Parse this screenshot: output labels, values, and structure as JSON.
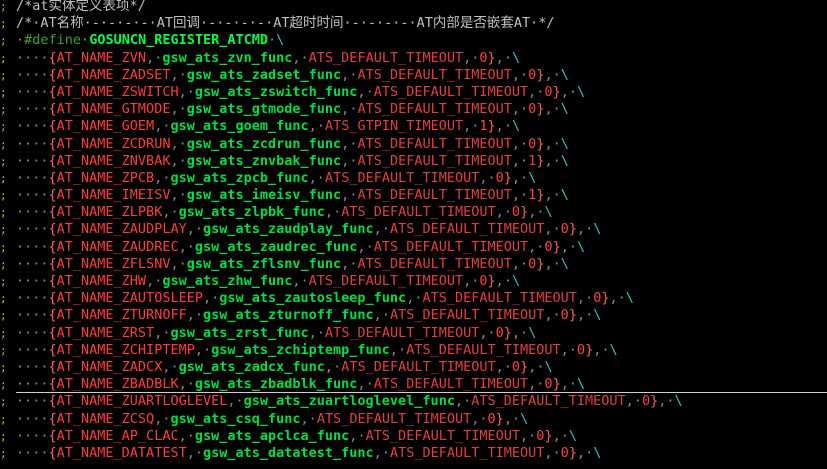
{
  "colors": {
    "background": "#000000",
    "comment": "#c0c0c0",
    "macro": "#00ff40",
    "function": "#00e040",
    "constant": "#ff3c3c",
    "continuation": "#40c0c0",
    "gutter_marker": "#c8c800"
  },
  "editor": {
    "comment_line_1": "/*at实体定义表项*/",
    "comment_line_2": "/*·AT名称·-·-·-·-·AT回调·-·-·-·-·AT超时时间·-·-·-·-·AT内部是否嵌套AT·*/",
    "define_keyword": "#define",
    "define_name": "GOSUNCN_REGISTER_ATCMD",
    "continuation": "\\",
    "entries": [
      {
        "name": "AT_NAME_ZVN",
        "func": "gsw_ats_zvn_func",
        "timeout": "ATS_DEFAULT_TIMEOUT",
        "nested": "0"
      },
      {
        "name": "AT_NAME_ZADSET",
        "func": "gsw_ats_zadset_func",
        "timeout": "ATS_DEFAULT_TIMEOUT",
        "nested": "0"
      },
      {
        "name": "AT_NAME_ZSWITCH",
        "func": "gsw_ats_zswitch_func",
        "timeout": "ATS_DEFAULT_TIMEOUT",
        "nested": "0"
      },
      {
        "name": "AT_NAME_GTMODE",
        "func": "gsw_ats_gtmode_func",
        "timeout": "ATS_DEFAULT_TIMEOUT",
        "nested": "0"
      },
      {
        "name": "AT_NAME_GOEM",
        "func": "gsw_ats_goem_func",
        "timeout": "ATS_GTPIN_TIMEOUT",
        "nested": "1"
      },
      {
        "name": "AT_NAME_ZCDRUN",
        "func": "gsw_ats_zcdrun_func",
        "timeout": "ATS_DEFAULT_TIMEOUT",
        "nested": "0"
      },
      {
        "name": "AT_NAME_ZNVBAK",
        "func": "gsw_ats_znvbak_func",
        "timeout": "ATS_DEFAULT_TIMEOUT",
        "nested": "1"
      },
      {
        "name": "AT_NAME_ZPCB",
        "func": "gsw_ats_zpcb_func",
        "timeout": "ATS_DEFAULT_TIMEOUT",
        "nested": "0"
      },
      {
        "name": "AT_NAME_IMEISV",
        "func": "gsw_ats_imeisv_func",
        "timeout": "ATS_DEFAULT_TIMEOUT",
        "nested": "1"
      },
      {
        "name": "AT_NAME_ZLPBK",
        "func": "gsw_ats_zlpbk_func",
        "timeout": "ATS_DEFAULT_TIMEOUT",
        "nested": "0"
      },
      {
        "name": "AT_NAME_ZAUDPLAY",
        "func": "gsw_ats_zaudplay_func",
        "timeout": "ATS_DEFAULT_TIMEOUT",
        "nested": "0"
      },
      {
        "name": "AT_NAME_ZAUDREC",
        "func": "gsw_ats_zaudrec_func",
        "timeout": "ATS_DEFAULT_TIMEOUT",
        "nested": "0"
      },
      {
        "name": "AT_NAME_ZFLSNV",
        "func": "gsw_ats_zflsnv_func",
        "timeout": "ATS_DEFAULT_TIMEOUT",
        "nested": "0"
      },
      {
        "name": "AT_NAME_ZHW",
        "func": "gsw_ats_zhw_func",
        "timeout": "ATS_DEFAULT_TIMEOUT",
        "nested": "0"
      },
      {
        "name": "AT_NAME_ZAUTOSLEEP",
        "func": "gsw_ats_zautosleep_func",
        "timeout": "ATS_DEFAULT_TIMEOUT",
        "nested": "0"
      },
      {
        "name": "AT_NAME_ZTURNOFF",
        "func": "gsw_ats_zturnoff_func",
        "timeout": "ATS_DEFAULT_TIMEOUT",
        "nested": "0"
      },
      {
        "name": "AT_NAME_ZRST",
        "func": "gsw_ats_zrst_func",
        "timeout": "ATS_DEFAULT_TIMEOUT",
        "nested": "0"
      },
      {
        "name": "AT_NAME_ZCHIPTEMP",
        "func": "gsw_ats_zchiptemp_func",
        "timeout": "ATS_DEFAULT_TIMEOUT",
        "nested": "0"
      },
      {
        "name": "AT_NAME_ZADCX",
        "func": "gsw_ats_zadcx_func",
        "timeout": "ATS_DEFAULT_TIMEOUT",
        "nested": "0"
      },
      {
        "name": "AT_NAME_ZBADBLK",
        "func": "gsw_ats_zbadblk_func",
        "timeout": "ATS_DEFAULT_TIMEOUT",
        "nested": "0"
      },
      {
        "name": "AT_NAME_ZUARTLOGLEVEL",
        "func": "gsw_ats_zuartloglevel_func",
        "timeout": "ATS_DEFAULT_TIMEOUT",
        "nested": "0"
      },
      {
        "name": "AT_NAME_ZCSQ",
        "func": "gsw_ats_csq_func",
        "timeout": "ATS_DEFAULT_TIMEOUT",
        "nested": "0"
      },
      {
        "name": "AT_NAME_AP_CLAC",
        "func": "gsw_ats_apclca_func",
        "timeout": "ATS_DEFAULT_TIMEOUT",
        "nested": "0"
      },
      {
        "name": "AT_NAME_DATATEST",
        "func": "gsw_ats_datatest_func",
        "timeout": "ATS_DEFAULT_TIMEOUT",
        "nested": "0"
      }
    ]
  }
}
